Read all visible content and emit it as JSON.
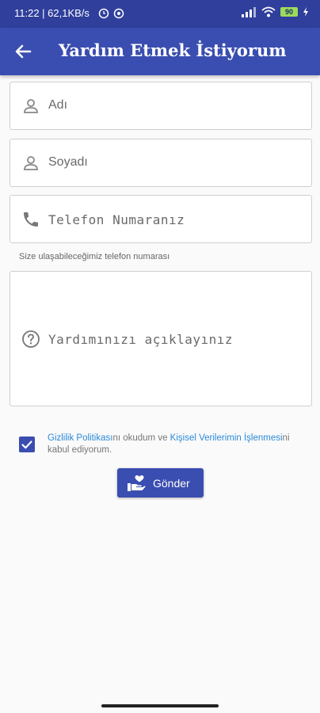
{
  "statusbar": {
    "time_speed": "11:22 | 62,1KB/s",
    "battery": "90"
  },
  "appbar": {
    "title": "Yardım Etmek İstiyorum"
  },
  "form": {
    "first_name_placeholder": "Adı",
    "last_name_placeholder": "Soyadı",
    "phone_placeholder": "Telefon Numaranız",
    "phone_helper": "Size ulaşabileceğimiz telefon numarası",
    "description_placeholder": "Yardımınızı açıklayınız"
  },
  "consent": {
    "checked": true,
    "privacy_link": "Gizlilik Politikası",
    "middle_text": "nı okudum ve ",
    "data_link": "Kişisel Verilerimin İşlenmesi",
    "end_text": "ni kabul ediyorum."
  },
  "submit": {
    "label": "Gönder"
  },
  "colors": {
    "primary": "#3a4db0",
    "statusbar": "#2f3f9b",
    "link": "#2b8ad9"
  }
}
